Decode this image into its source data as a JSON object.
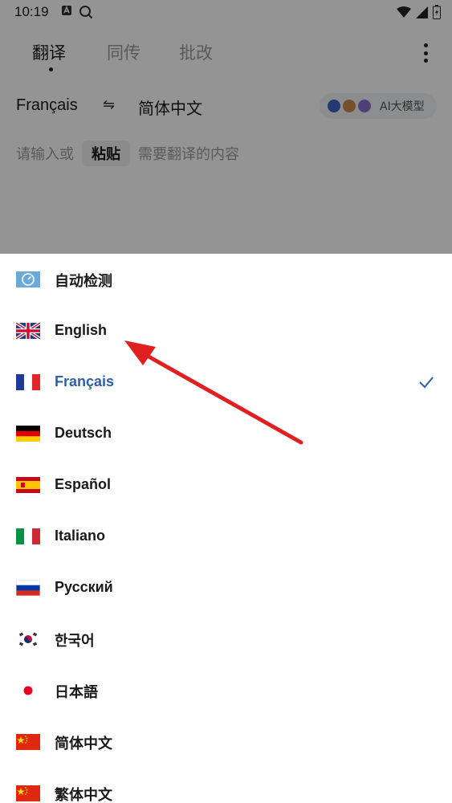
{
  "status": {
    "time": "10:19"
  },
  "tabs": [
    {
      "label": "翻译"
    },
    {
      "label": "同传"
    },
    {
      "label": "批改"
    }
  ],
  "language_bar": {
    "source": "Français",
    "target": "简体中文",
    "ai_label": "AI大模型"
  },
  "input": {
    "hint_before": "请输入或",
    "paste_label": "粘贴",
    "hint_after": "需要翻译的内容"
  },
  "sheet": {
    "items": [
      {
        "label": "自动检测",
        "flag": "auto-detect-icon"
      },
      {
        "label": "English",
        "flag": "uk-flag-icon"
      },
      {
        "label": "Français",
        "flag": "france-flag-icon",
        "selected": true
      },
      {
        "label": "Deutsch",
        "flag": "germany-flag-icon"
      },
      {
        "label": "Español",
        "flag": "spain-flag-icon"
      },
      {
        "label": "Italiano",
        "flag": "italy-flag-icon"
      },
      {
        "label": "Русский",
        "flag": "russia-flag-icon"
      },
      {
        "label": "한국어",
        "flag": "korea-flag-icon"
      },
      {
        "label": "日本語",
        "flag": "japan-flag-icon"
      },
      {
        "label": "简体中文",
        "flag": "china-flag-icon"
      },
      {
        "label": "繁体中文",
        "flag": "china-flag-icon"
      }
    ]
  },
  "colors": {
    "selected_text": "#2d5fa6",
    "annotation_arrow": "#e02020",
    "scrim": "rgba(0,0,0,0.42)"
  }
}
